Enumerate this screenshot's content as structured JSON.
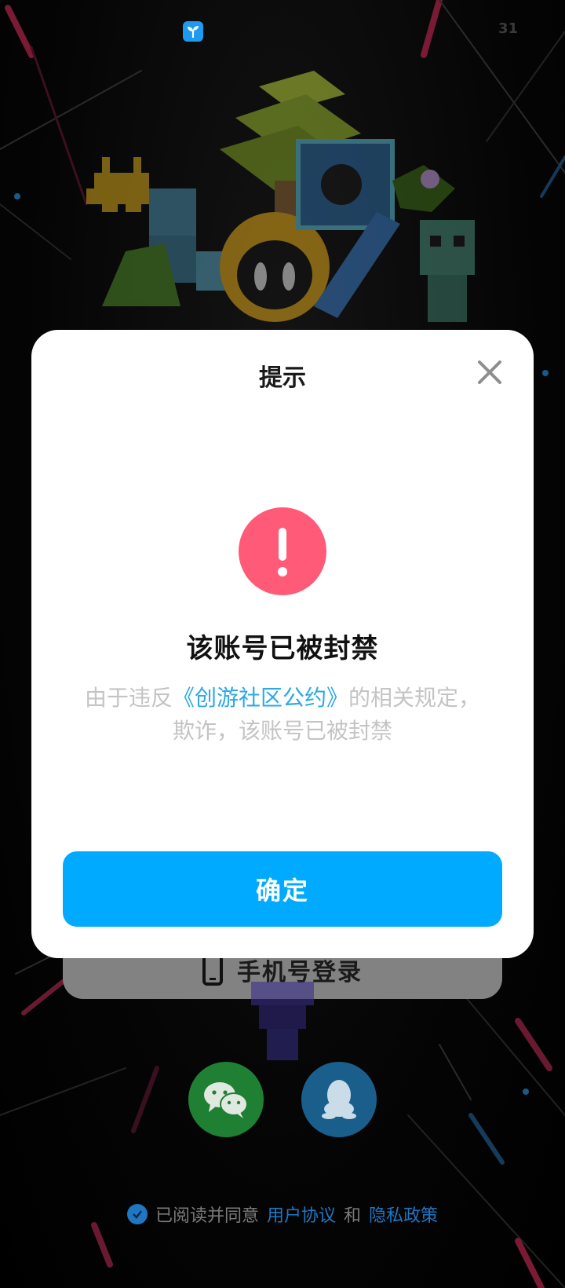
{
  "status_bar": {
    "app_icon": "sprout-app-icon",
    "battery_text": "31"
  },
  "background": {
    "hero_art": "pixel-voxel-island-illustration"
  },
  "login": {
    "phone_login_label": "手机号登录",
    "wechat_icon": "wechat-icon",
    "qq_icon": "qq-icon"
  },
  "agreement": {
    "prefix": "已阅读并同意",
    "user_agreement": "用户协议",
    "and": "和",
    "privacy_policy": "隐私政策"
  },
  "modal": {
    "title": "提示",
    "heading": "该账号已被封禁",
    "message_prefix": "由于违反",
    "message_link": "《创游社区公约》",
    "message_suffix": "的相关规定，欺诈，该账号已被封禁",
    "confirm_label": "确定"
  },
  "colors": {
    "accent": "#00aaff",
    "alert": "#ff5a78",
    "link": "#2aa8e8"
  }
}
